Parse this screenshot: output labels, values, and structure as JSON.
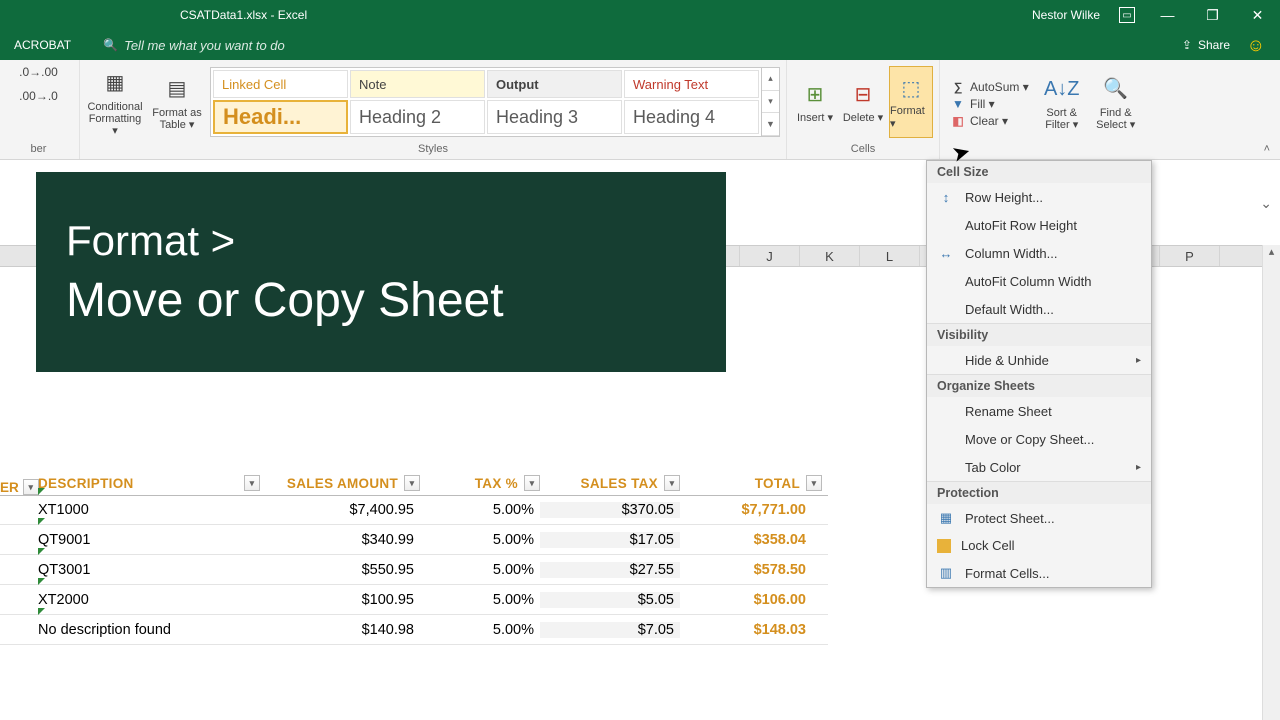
{
  "titlebar": {
    "doc": "CSATData1.xlsx  -  Excel",
    "user": "Nestor Wilke"
  },
  "tabrow": {
    "acrobat": "ACROBAT",
    "searchPlaceholder": "Tell me what you want to do",
    "share": "Share"
  },
  "ribbon": {
    "numberGroup": "ber",
    "condFmt": "Conditional Formatting ▾",
    "fmtTable": "Format as Table ▾",
    "stylesLabel": "Styles",
    "styles": {
      "linked": "Linked Cell",
      "note": "Note",
      "output": "Output",
      "warn": "Warning Text",
      "h1": "Headi...",
      "h2": "Heading 2",
      "h3": "Heading 3",
      "h4": "Heading 4"
    },
    "cells": {
      "insert": "Insert ▾",
      "delete": "Delete ▾",
      "format": "Format ▾",
      "label": "Cells"
    },
    "editing": {
      "autosum": "AutoSum ▾",
      "fill": "Fill ▾",
      "clear": "Clear ▾",
      "sort": "Sort & Filter ▾",
      "find": "Find & Select ▾"
    }
  },
  "columns": {
    "j": "J",
    "k": "K",
    "l": "L",
    "p": "P"
  },
  "banner": {
    "l1": "Format >",
    "l2": "Move or Copy Sheet"
  },
  "tableHeaders": {
    "er": "ER",
    "desc": "DESCRIPTION",
    "sales": "SALES AMOUNT",
    "taxp": "TAX %",
    "taxv": "SALES TAX",
    "total": "TOTAL"
  },
  "rows": [
    {
      "desc": "XT1000",
      "sales": "$7,400.95",
      "taxp": "5.00%",
      "taxv": "$370.05",
      "total": "$7,771.00"
    },
    {
      "desc": "QT9001",
      "sales": "$340.99",
      "taxp": "5.00%",
      "taxv": "$17.05",
      "total": "$358.04"
    },
    {
      "desc": "QT3001",
      "sales": "$550.95",
      "taxp": "5.00%",
      "taxv": "$27.55",
      "total": "$578.50"
    },
    {
      "desc": "XT2000",
      "sales": "$100.95",
      "taxp": "5.00%",
      "taxv": "$5.05",
      "total": "$106.00"
    },
    {
      "desc": "No description found",
      "sales": "$140.98",
      "taxp": "5.00%",
      "taxv": "$7.05",
      "total": "$148.03"
    }
  ],
  "formatMenu": {
    "sect1": "Cell Size",
    "rowHeight": "Row Height...",
    "autoRow": "AutoFit Row Height",
    "colWidth": "Column Width...",
    "autoCol": "AutoFit Column Width",
    "defWidth": "Default Width...",
    "sect2": "Visibility",
    "hide": "Hide & Unhide",
    "sect3": "Organize Sheets",
    "rename": "Rename Sheet",
    "move": "Move or Copy Sheet...",
    "tabColor": "Tab Color",
    "sect4": "Protection",
    "protect": "Protect Sheet...",
    "lock": "Lock Cell",
    "fmtCells": "Format Cells..."
  }
}
